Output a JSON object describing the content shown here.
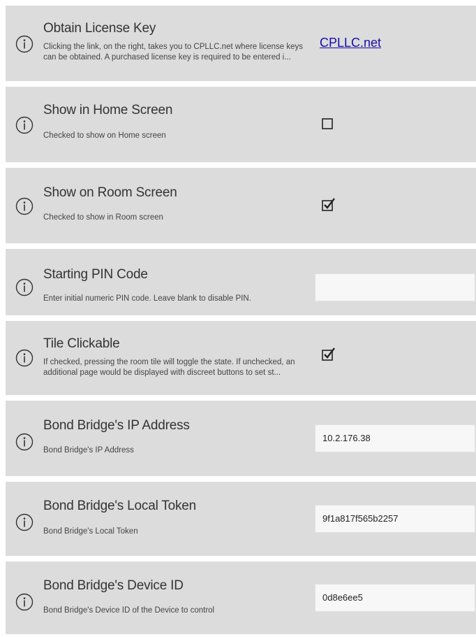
{
  "settings": {
    "license": {
      "title": "Obtain License Key",
      "description": "Clicking the link, on the right, takes you to CPLLC.net where license keys can be obtained.  A purchased license key is required to be entered i...",
      "link_label": "CPLLC.net"
    },
    "home_screen": {
      "title": "Show in Home Screen",
      "description": "Checked to show on Home screen",
      "checked": false
    },
    "room_screen": {
      "title": "Show on Room Screen",
      "description": "Checked to show in Room screen",
      "checked": true
    },
    "pin_code": {
      "title": "Starting PIN Code",
      "description": "Enter initial numeric PIN code.  Leave blank to disable PIN.",
      "value": ""
    },
    "tile_clickable": {
      "title": "Tile Clickable",
      "description": "If checked, pressing the room tile will toggle the state.  If unchecked, an additional page would  be displayed with discreet buttons to set st...",
      "checked": true
    },
    "ip_address": {
      "title": "Bond Bridge's IP Address",
      "description": "Bond Bridge's IP Address",
      "value": "10.2.176.38"
    },
    "local_token": {
      "title": "Bond Bridge's Local Token",
      "description": "Bond Bridge's Local Token",
      "value": "9f1a817f565b2257"
    },
    "device_id": {
      "title": "Bond Bridge's Device ID",
      "description": "Bond Bridge's Device ID of the Device to control",
      "value": "0d8e6ee5"
    }
  }
}
